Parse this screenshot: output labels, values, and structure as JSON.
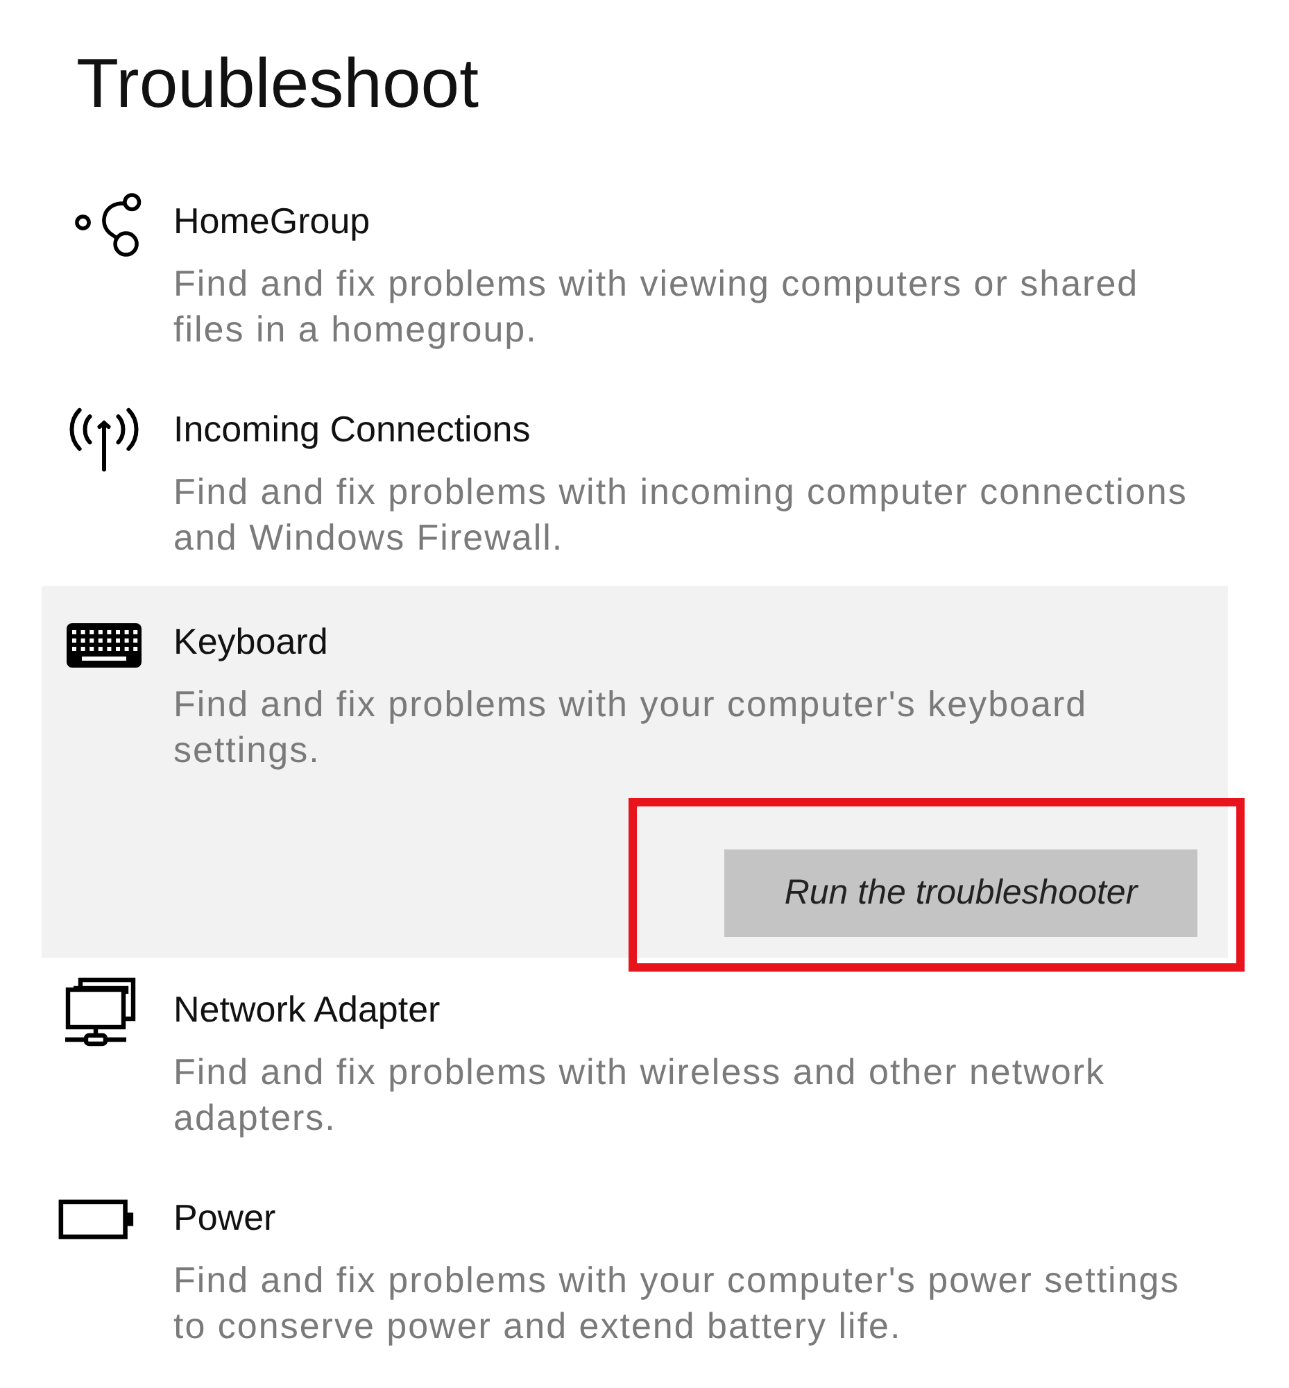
{
  "title": "Troubleshoot",
  "items": [
    {
      "kind": "homegroup",
      "name": "HomeGroup",
      "description": "Find and fix problems with viewing computers or shared files in a homegroup.",
      "selected": false
    },
    {
      "kind": "incoming",
      "name": "Incoming Connections",
      "description": "Find and fix problems with incoming computer connections and Windows Firewall.",
      "selected": false
    },
    {
      "kind": "keyboard",
      "name": "Keyboard",
      "description": "Find and fix problems with your computer's keyboard settings.",
      "selected": true,
      "button": {
        "label": "Run the troubleshooter",
        "highlighted": true
      }
    },
    {
      "kind": "network",
      "name": "Network Adapter",
      "description": "Find and fix problems with wireless and other network adapters.",
      "selected": false
    },
    {
      "kind": "power",
      "name": "Power",
      "description": "Find and fix problems with your computer's power settings to conserve power and extend battery life.",
      "selected": false
    }
  ]
}
